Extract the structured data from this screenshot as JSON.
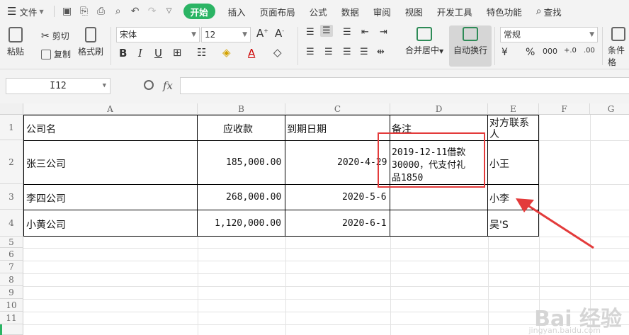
{
  "menubar": {
    "file_label": "文件",
    "tabs": [
      "开始",
      "插入",
      "页面布局",
      "公式",
      "数据",
      "审阅",
      "视图",
      "开发工具",
      "特色功能"
    ],
    "search_label": "查找",
    "accent_color": "#2bb464"
  },
  "ribbon": {
    "paste": "粘贴",
    "cut": "剪切",
    "copy": "复制",
    "format_painter": "格式刷",
    "font_name": "宋体",
    "font_size": "12",
    "merge_center": "合并居中",
    "auto_wrap": "自动换行",
    "number_format": "常规",
    "conditional": "条件格"
  },
  "formula_bar": {
    "cell_ref": "I12",
    "fx": "fx",
    "value": ""
  },
  "sheet": {
    "columns": [
      "A",
      "B",
      "C",
      "D",
      "E",
      "F",
      "G"
    ],
    "rows": [
      "1",
      "2",
      "3",
      "4",
      "5",
      "6",
      "7",
      "8",
      "9",
      "10",
      "11"
    ],
    "header": {
      "a": "公司名",
      "b": "应收款",
      "c": "到期日期",
      "d": "备注",
      "e1": "对方联系",
      "e2": "人"
    },
    "data": [
      {
        "a": "张三公司",
        "b": "185,000.00",
        "c": "2020-4-29",
        "d1": "2019-12-11借款",
        "d2": "30000，代支付礼",
        "d3": "品1850",
        "e": "小王"
      },
      {
        "a": "李四公司",
        "b": "268,000.00",
        "c": "2020-5-6",
        "e": "小李"
      },
      {
        "a": "小黄公司",
        "b": "1,120,000.00",
        "c": "2020-6-1",
        "e": "吴'S"
      }
    ]
  },
  "annotation": {
    "highlight_color": "#e33b3b",
    "arrow_color": "#e33b3b"
  },
  "watermark": {
    "text": "Bai 经验",
    "sub": "jingyan.baidu.com"
  }
}
